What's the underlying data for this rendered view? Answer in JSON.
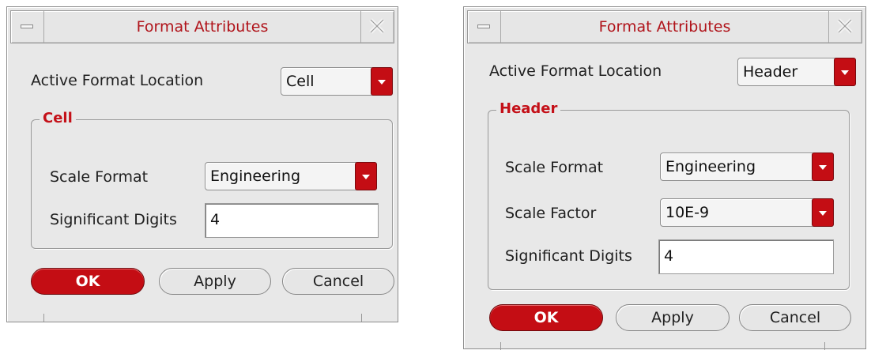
{
  "dialogs": [
    {
      "title": "Format Attributes",
      "active_location_label": "Active Format Location",
      "active_location_value": "Cell",
      "group_title": "Cell",
      "scale_format_label": "Scale Format",
      "scale_format_value": "Engineering",
      "significant_digits_label": "Significant Digits",
      "significant_digits_value": "4",
      "buttons": {
        "ok": "OK",
        "apply": "Apply",
        "cancel": "Cancel"
      }
    },
    {
      "title": "Format Attributes",
      "active_location_label": "Active Format Location",
      "active_location_value": "Header",
      "group_title": "Header",
      "scale_format_label": "Scale Format",
      "scale_format_value": "Engineering",
      "scale_factor_label": "Scale Factor",
      "scale_factor_value": "10E-9",
      "significant_digits_label": "Significant Digits",
      "significant_digits_value": "4",
      "buttons": {
        "ok": "OK",
        "apply": "Apply",
        "cancel": "Cancel"
      }
    }
  ],
  "icons": {
    "window_menu": "window-menu-icon",
    "close": "close-icon",
    "dropdown": "chevron-down-icon"
  },
  "colors": {
    "accent": "#c40d14",
    "title_text": "#b0131a",
    "dialog_bg": "#e8e8e8"
  }
}
